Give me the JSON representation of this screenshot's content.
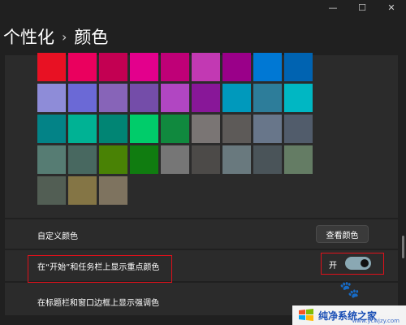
{
  "window": {
    "minimize_icon": "minimize-icon",
    "maximize_icon": "maximize-icon",
    "close_icon": "close-icon"
  },
  "breadcrumb": {
    "parent": "个性化",
    "separator": "›",
    "current": "颜色"
  },
  "color_grid": {
    "rows": [
      [
        "#e81123",
        "#ea005e",
        "#c30052",
        "#e3008c",
        "#bf0077",
        "#c239b3",
        "#9a0089",
        "#0078d4",
        "#0063b1"
      ],
      [
        "#8e8cd8",
        "#6b69d6",
        "#8764b8",
        "#744da9",
        "#b146c2",
        "#881798",
        "#0099bc",
        "#2d7d9a",
        "#00b7c3"
      ],
      [
        "#038387",
        "#00b294",
        "#018574",
        "#00cc6a",
        "#10893e",
        "#7a7574",
        "#5d5a58",
        "#68768a",
        "#515c6b"
      ],
      [
        "#567c73",
        "#486860",
        "#498205",
        "#107c10",
        "#767676",
        "#4c4a48",
        "#69797e",
        "#4a5459",
        "#647c64"
      ],
      [
        "#525e54",
        "#847545",
        "#7e735f"
      ]
    ]
  },
  "custom_color": {
    "label": "自定义颜色",
    "button_label": "查看颜色"
  },
  "start_taskbar": {
    "label": "在“开始”和任务栏上显示重点颜色",
    "state_text": "开",
    "toggle_on": true
  },
  "title_bars": {
    "label": "在标题栏和窗口边框上显示强调色"
  },
  "watermark": {
    "text": "纯净系统之家",
    "url": "www.ycwjzy.com"
  },
  "colors": {
    "highlight": "#e0101a",
    "background": "#202020",
    "card": "#2b2b2b",
    "toggle_track": "#8aa8b3"
  }
}
